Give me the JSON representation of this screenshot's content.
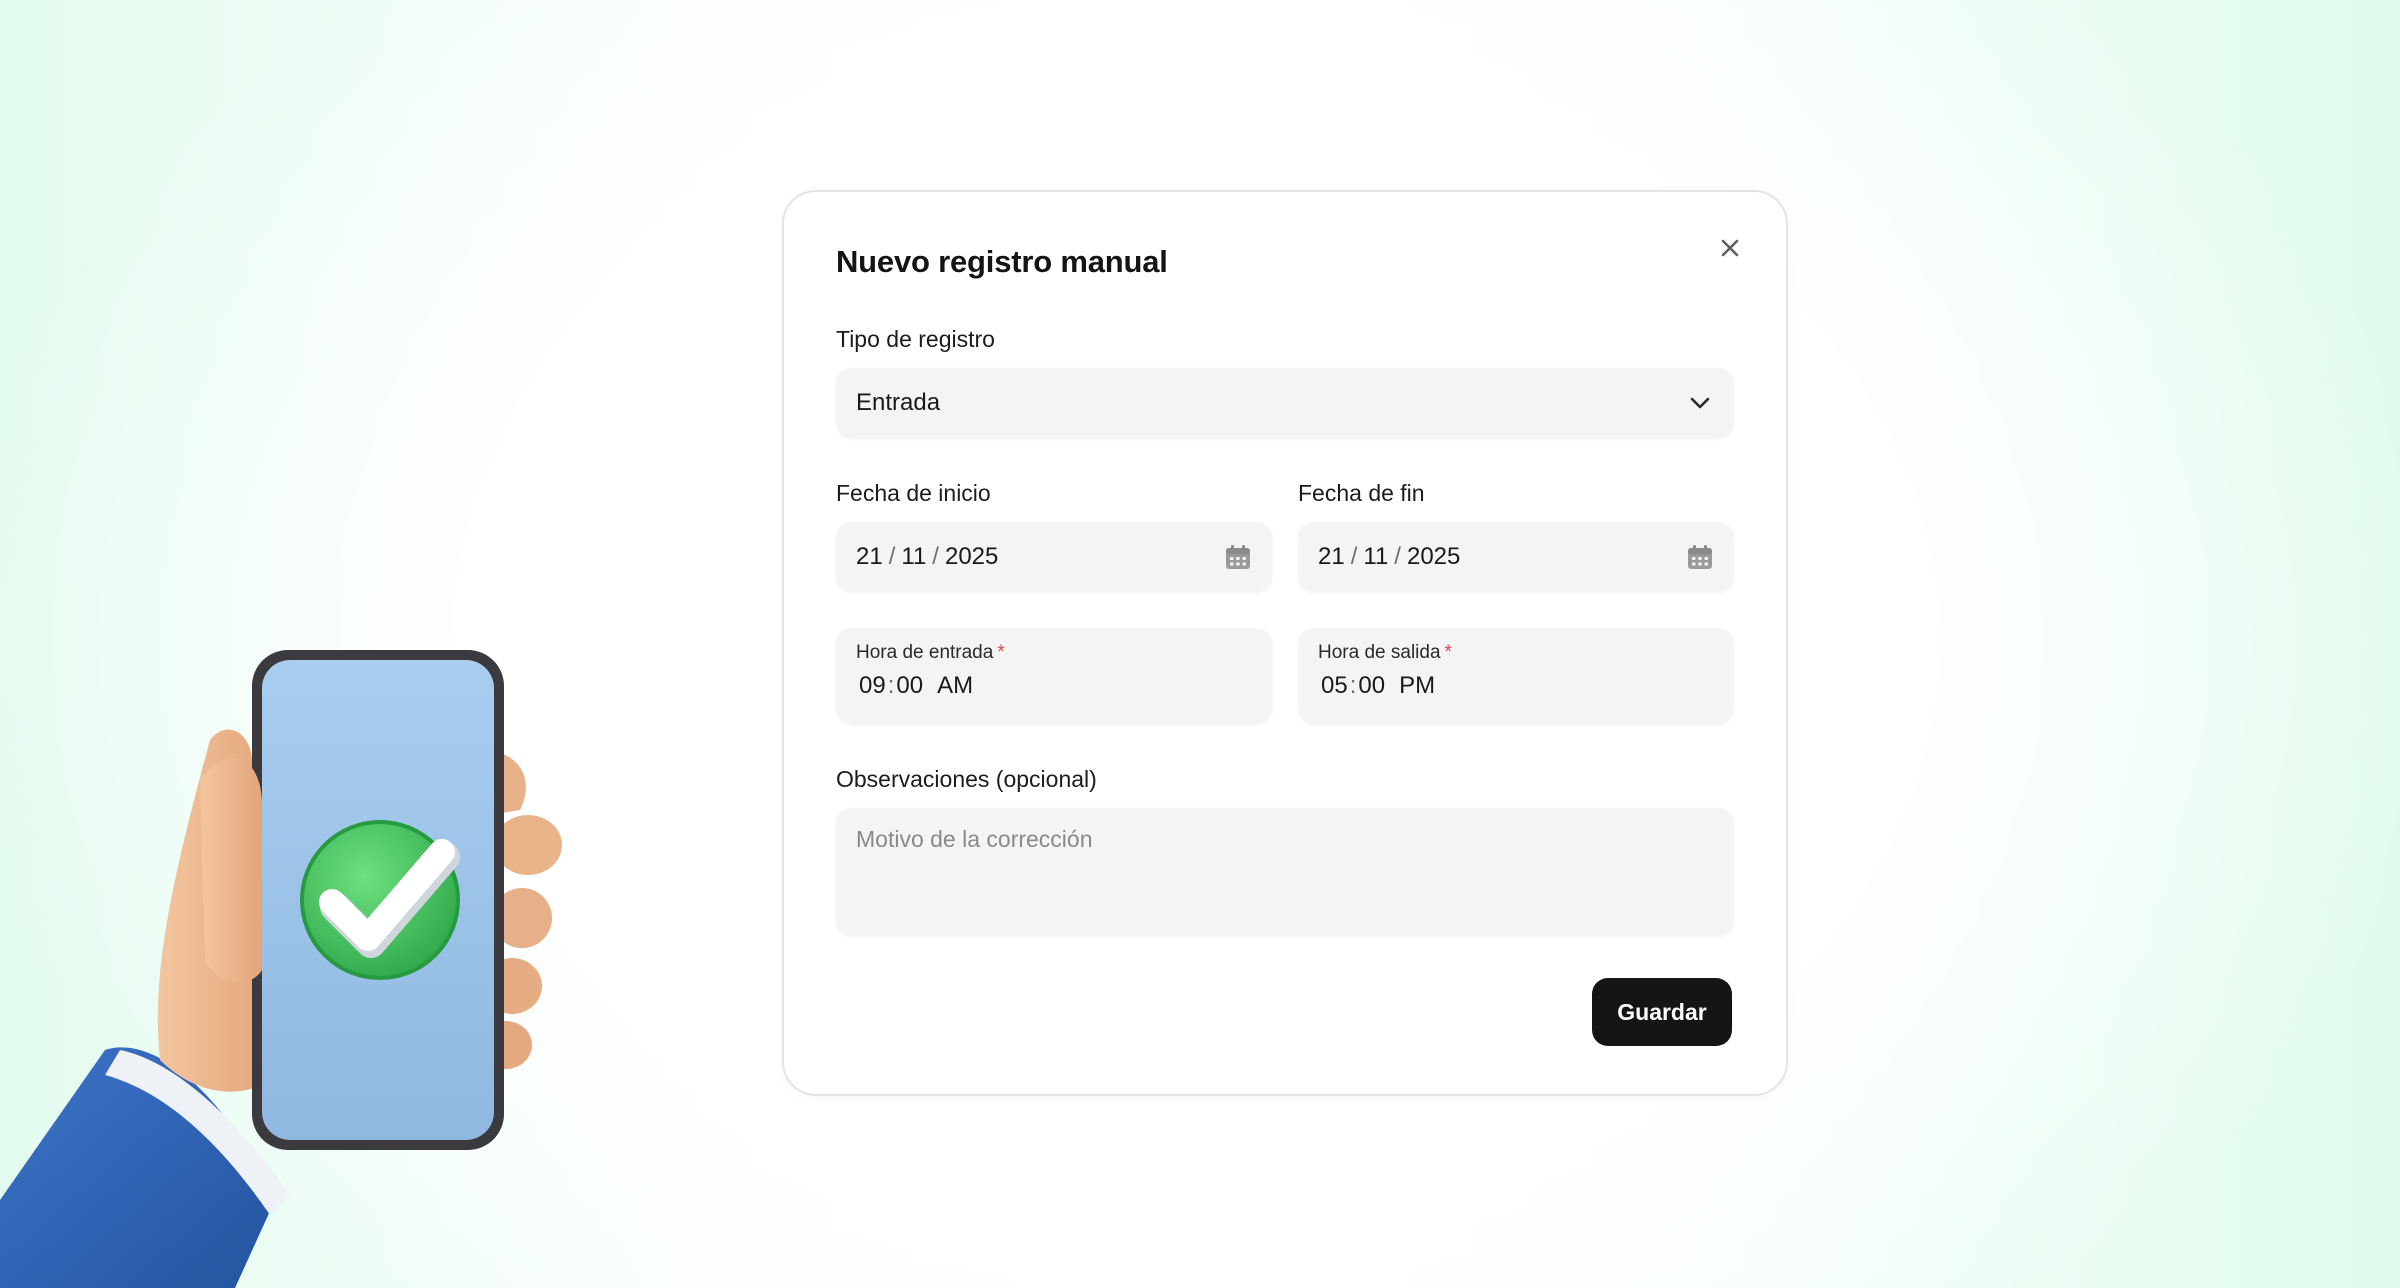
{
  "modal": {
    "title": "Nuevo registro manual",
    "close_icon": "close-icon"
  },
  "record_type": {
    "label": "Tipo de registro",
    "selected": "Entrada",
    "icon": "chevron-down-icon"
  },
  "start_date": {
    "label": "Fecha de inicio",
    "day": "21",
    "month": "11",
    "year": "2025",
    "separator": "/",
    "icon": "calendar-icon"
  },
  "end_date": {
    "label": "Fecha de fin",
    "day": "21",
    "month": "11",
    "year": "2025",
    "separator": "/",
    "icon": "calendar-icon"
  },
  "entry_time": {
    "label": "Hora de entrada",
    "required": "*",
    "hour": "09",
    "minute": "00",
    "separator": ":",
    "period": "AM"
  },
  "exit_time": {
    "label": "Hora de salida",
    "required": "*",
    "hour": "05",
    "minute": "00",
    "separator": ":",
    "period": "PM"
  },
  "notes": {
    "label": "Observaciones (opcional)",
    "placeholder": "Motivo de la corrección"
  },
  "actions": {
    "save_label": "Guardar"
  },
  "colors": {
    "accent": "#151515",
    "required": "#e5484d",
    "field_bg": "#f4f4f4",
    "check_green": "#3fbf5e"
  }
}
